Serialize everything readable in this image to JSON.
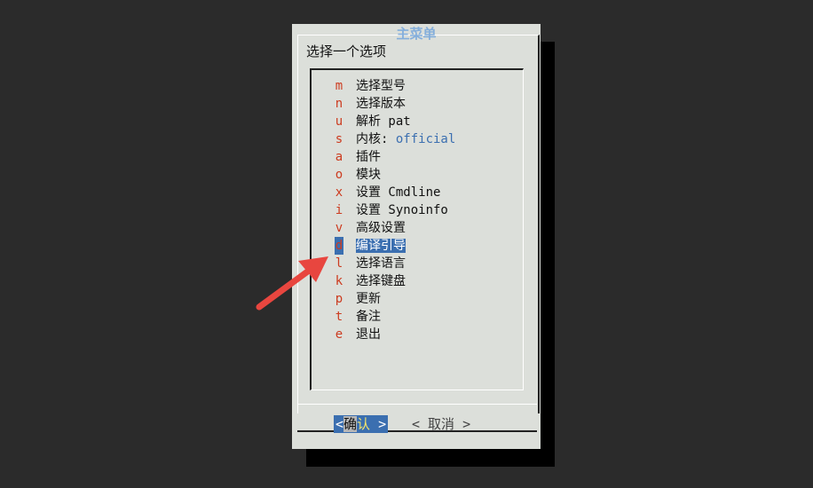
{
  "dialog": {
    "title": "主菜单",
    "prompt": "选择一个选项",
    "items": [
      {
        "key": "m",
        "label": "选择型号"
      },
      {
        "key": "n",
        "label": "选择版本"
      },
      {
        "key": "u",
        "label": "解析 pat"
      },
      {
        "key": "s",
        "label": "内核: ",
        "value": "official"
      },
      {
        "key": "a",
        "label": "插件"
      },
      {
        "key": "o",
        "label": "模块"
      },
      {
        "key": "x",
        "label": "设置 Cmdline"
      },
      {
        "key": "i",
        "label": "设置 Synoinfo"
      },
      {
        "key": "v",
        "label": "高级设置"
      },
      {
        "key": "d",
        "label": "编译引导",
        "selected": true
      },
      {
        "key": "l",
        "label": "选择语言"
      },
      {
        "key": "k",
        "label": "选择键盘"
      },
      {
        "key": "p",
        "label": "更新"
      },
      {
        "key": "t",
        "label": "备注"
      },
      {
        "key": "e",
        "label": "退出"
      }
    ],
    "ok": {
      "open": "<",
      "first": "确",
      "hot": "认",
      "close": ">"
    },
    "cancel": "< 取消 >"
  },
  "colors": {
    "background": "#2b2b2b",
    "dialog": "#dcdfda",
    "highlight": "#3b6fb0",
    "hotkey": "#cc3b1f",
    "title": "#84aedb",
    "annotation_arrow": "#e8463f"
  }
}
